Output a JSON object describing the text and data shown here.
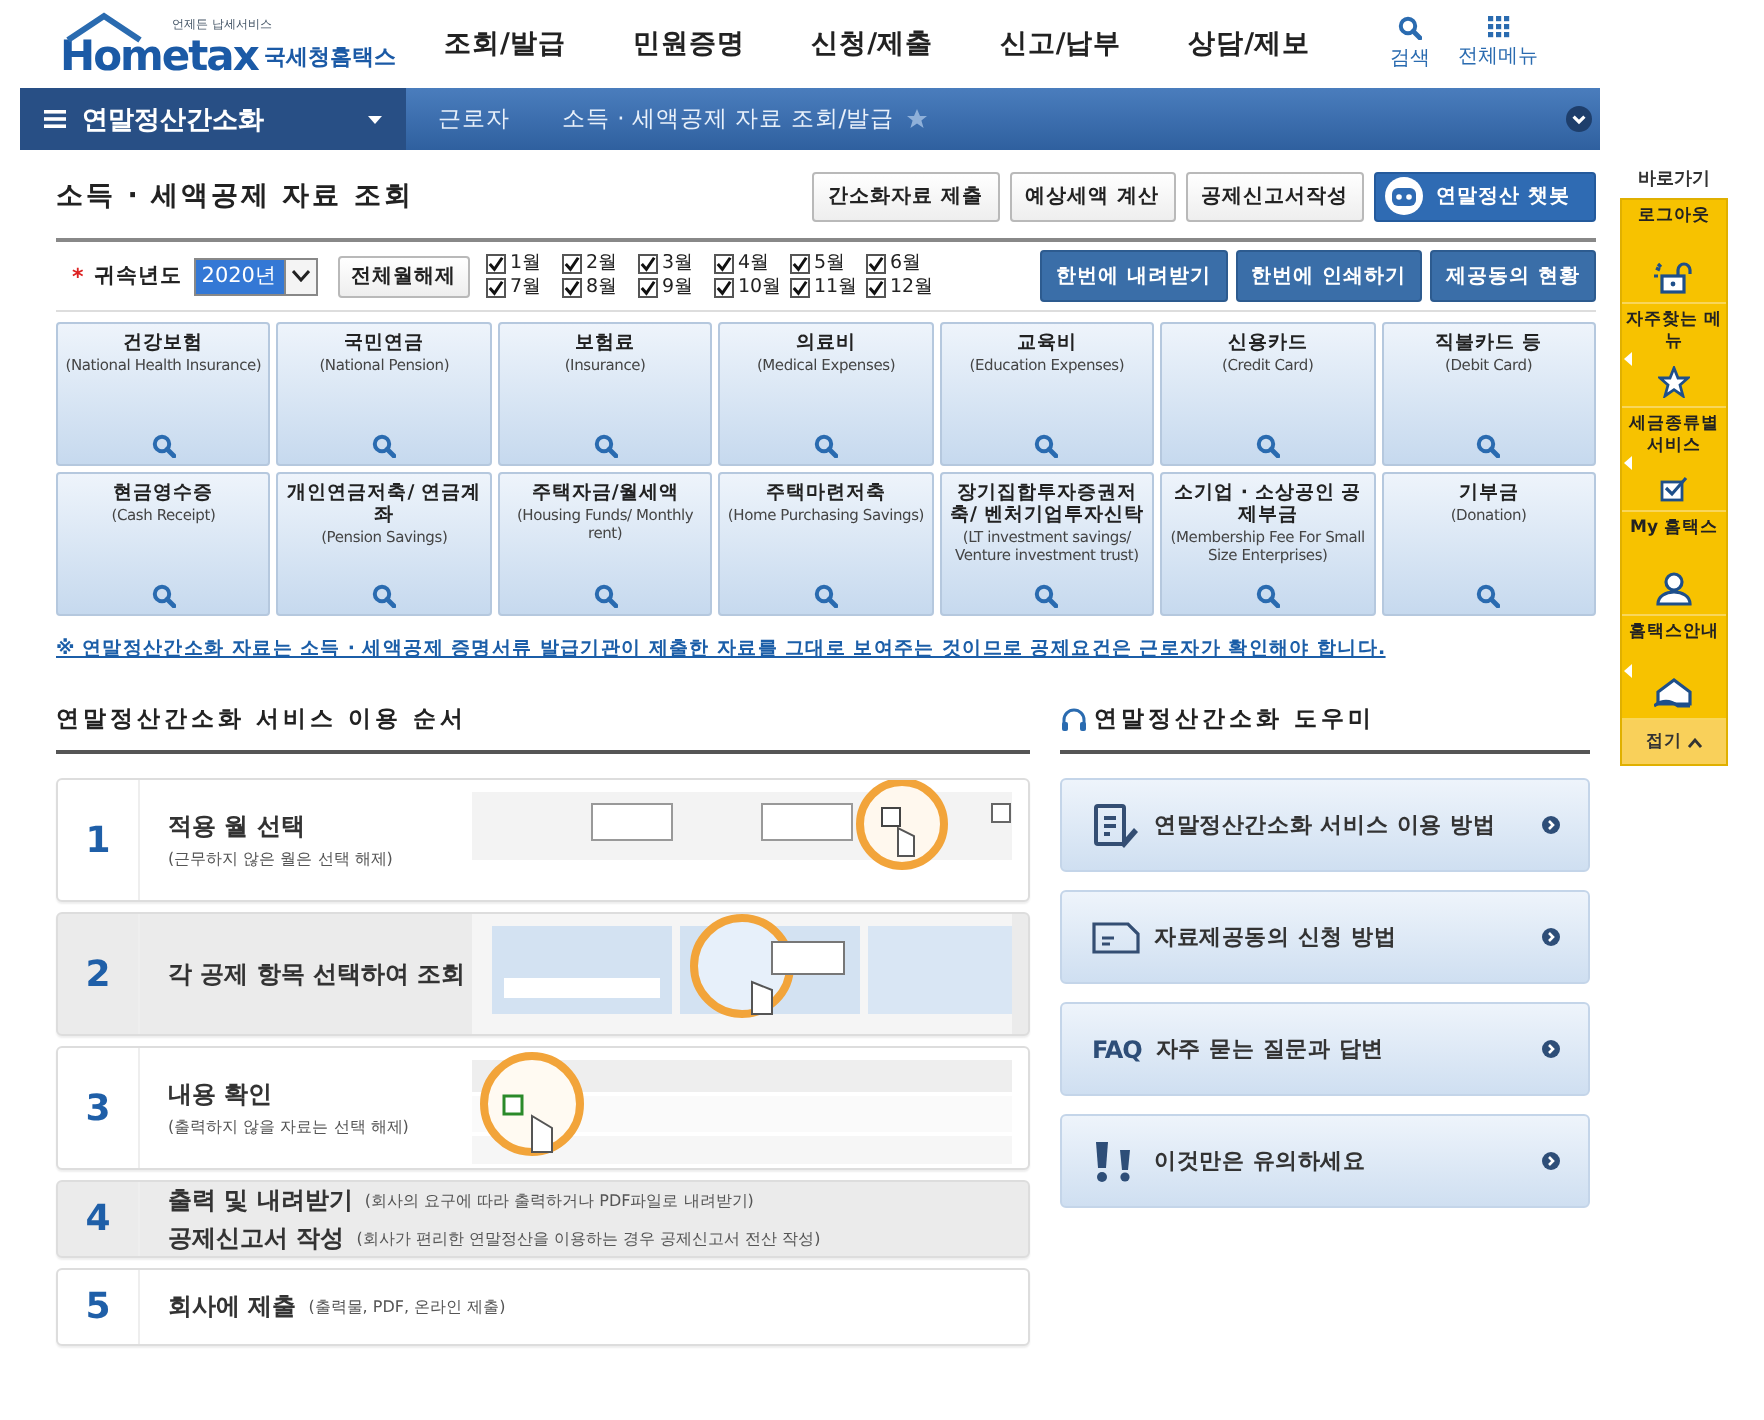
{
  "logo": {
    "tagline": "언제든 납세서비스",
    "brand": "Hometax",
    "name": "국세청홈택스"
  },
  "main_menu": [
    "조회/발급",
    "민원증명",
    "신청/제출",
    "신고/납부",
    "상담/제보"
  ],
  "utility": [
    {
      "label": "검색",
      "kind": "search"
    },
    {
      "label": "전체메뉴",
      "kind": "grid"
    }
  ],
  "breadcrumb": {
    "menu": "연말정산간소화",
    "items": [
      "근로자",
      "소득 · 세액공제 자료 조회/발급"
    ],
    "favorite": false
  },
  "page_title": "소득 · 세액공제 자료 조회",
  "top_buttons": [
    {
      "label": "간소화자료 제출",
      "kind": "plain"
    },
    {
      "label": "예상세액 계산",
      "kind": "plain"
    },
    {
      "label": "공제신고서작성",
      "kind": "plain"
    },
    {
      "label": "연말정산 챗봇",
      "kind": "chatbot"
    }
  ],
  "filter": {
    "label": "귀속년도",
    "required_mark": "*",
    "year": "2020년",
    "clear_button": "전체월해제",
    "months": [
      {
        "label": "1월",
        "checked": true
      },
      {
        "label": "2월",
        "checked": true
      },
      {
        "label": "3월",
        "checked": true
      },
      {
        "label": "4월",
        "checked": true
      },
      {
        "label": "5월",
        "checked": true
      },
      {
        "label": "6월",
        "checked": true
      },
      {
        "label": "7월",
        "checked": true
      },
      {
        "label": "8월",
        "checked": true
      },
      {
        "label": "9월",
        "checked": true
      },
      {
        "label": "10월",
        "checked": true
      },
      {
        "label": "11월",
        "checked": true
      },
      {
        "label": "12월",
        "checked": true
      }
    ],
    "actions": [
      "한번에 내려받기",
      "한번에 인쇄하기",
      "제공동의 현황"
    ]
  },
  "categories": [
    {
      "name": "건강보험",
      "english": "(National Health Insurance)"
    },
    {
      "name": "국민연금",
      "english": "(National Pension)"
    },
    {
      "name": "보험료",
      "english": "(Insurance)"
    },
    {
      "name": "의료비",
      "english": "(Medical Expenses)"
    },
    {
      "name": "교육비",
      "english": "(Education Expenses)"
    },
    {
      "name": "신용카드",
      "english": "(Credit Card)"
    },
    {
      "name": "직불카드 등",
      "english": "(Debit Card)"
    },
    {
      "name": "현금영수증",
      "english": "(Cash Receipt)"
    },
    {
      "name": "개인연금저축/ 연금계좌",
      "english": "(Pension Savings)"
    },
    {
      "name": "주택자금/월세액",
      "english": "(Housing Funds/ Monthly rent)"
    },
    {
      "name": "주택마련저축",
      "english": "(Home Purchasing Savings)"
    },
    {
      "name": "장기집합투자증권저축/ 벤처기업투자신탁",
      "english": "(LT investment savings/ Venture investment trust)"
    },
    {
      "name": "소기업 · 소상공인 공제부금",
      "english": "(Membership Fee For Small Size Enterprises)"
    },
    {
      "name": "기부금",
      "english": "(Donation)"
    }
  ],
  "notice": "※ 연말정산간소화 자료는 소득 · 세액공제 증명서류 발급기관이 제출한 자료를 그대로 보여주는 것이므로 공제요건은 근로자가 확인해야 합니다.",
  "guide": {
    "title": "연말정산간소화 서비스 이용 순서",
    "steps": [
      {
        "number": "1",
        "kind": "stacked",
        "shaded": false,
        "lines": [
          {
            "title": "적용 월 선택",
            "note": "(근무하지 않은 월은 선택 해제)"
          }
        ],
        "illustration": {
          "kind": "picture"
        }
      },
      {
        "number": "2",
        "kind": "stacked",
        "shaded": true,
        "lines": [
          {
            "title": "각 공제 항목 선택하여 조회"
          }
        ],
        "illustration": {
          "kind": "picture"
        }
      },
      {
        "number": "3",
        "kind": "stacked",
        "shaded": false,
        "lines": [
          {
            "title": "내용 확인",
            "note": "(출력하지 않을 자료는 선택 해제)"
          }
        ],
        "illustration": {
          "kind": "picture"
        }
      },
      {
        "number": "4",
        "kind": "inline",
        "shaded": true,
        "lines": [
          {
            "title": "출력 및 내려받기",
            "note": "(회사의 요구에 따라 출력하거나 PDF파일로 내려받기)"
          },
          {
            "title": "공제신고서 작성",
            "note": "(회사가 편리한 연말정산을 이용하는 경우 공제신고서 전산 작성)"
          }
        ]
      },
      {
        "number": "5",
        "kind": "inline",
        "shaded": false,
        "lines": [
          {
            "title": "회사에 제출",
            "note": "(출력물, PDF, 온라인 제출)"
          }
        ]
      }
    ]
  },
  "helper": {
    "title": "연말정산간소화 도우미",
    "links": [
      {
        "label": "연말정산간소화 서비스 이용 방법",
        "kind": "document"
      },
      {
        "label": "자료제공동의 신청 방법",
        "kind": "form"
      },
      {
        "label": "자주 묻는 질문과 답변",
        "kind": "text",
        "icon_text": "FAQ"
      },
      {
        "label": "이것만은 유의하세요",
        "kind": "exclaim"
      }
    ]
  },
  "quick": {
    "title": "바로가기",
    "items": [
      {
        "label": "로그아웃",
        "kind": "lock",
        "flyout": false
      },
      {
        "label": "자주찾는 메뉴",
        "kind": "star",
        "flyout": true
      },
      {
        "label": "세금종류별 서비스",
        "kind": "check",
        "flyout": true
      },
      {
        "label": "My 홈택스",
        "kind": "person",
        "flyout": false
      },
      {
        "label": "홈택스안내",
        "kind": "house",
        "flyout": true
      }
    ],
    "collapse": "접기"
  }
}
